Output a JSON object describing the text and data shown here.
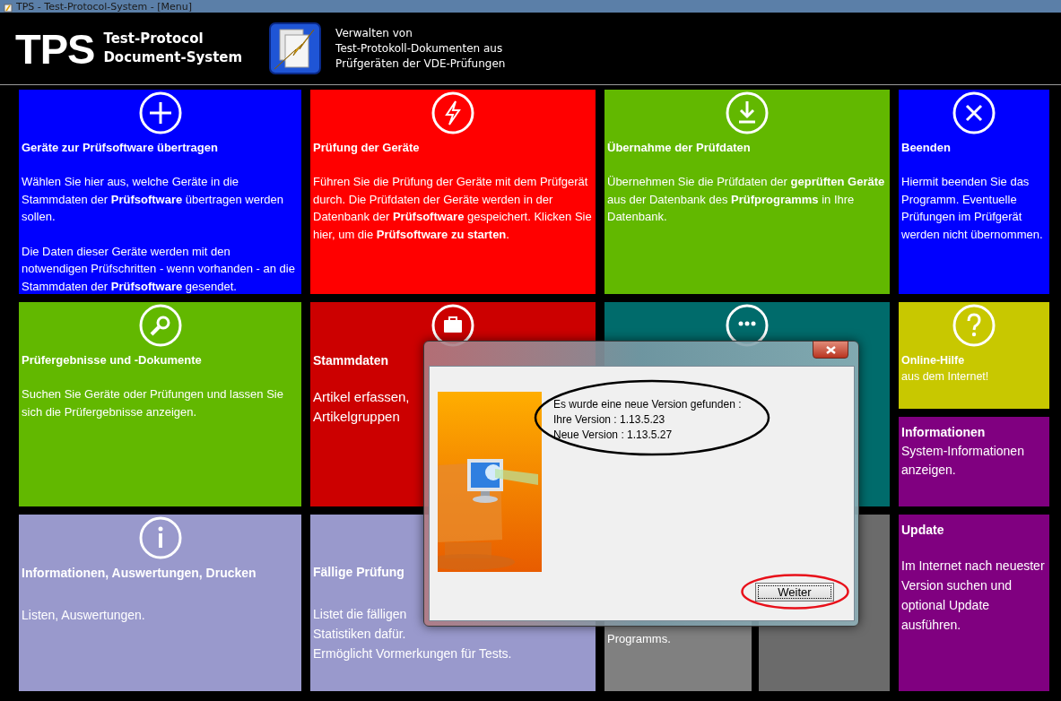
{
  "window": {
    "title": "TPS - Test-Protocol-System - [Menu]"
  },
  "header": {
    "logo": "TPS",
    "product_name": [
      "Test-Protocol",
      "Document-System"
    ],
    "description": [
      "Verwalten von",
      "Test-Protokoll-Dokumenten aus",
      "Prüfgeräten der VDE-Prüfungen"
    ]
  },
  "tiles": [
    {
      "color": "#0000ff",
      "title": "Geräte zur Prüfsoftware übertragen",
      "body": [
        "Wählen Sie hier aus, welche Geräte in die Stammdaten der **Prüfsoftware** übertragen werden sollen.",
        "Die Daten dieser Geräte werden mit den notwendigen Prüfschritten - wenn vorhanden - an die Stammdaten  der **Prüfsoftware** gesendet."
      ]
    },
    {
      "color": "#ff0000",
      "title": "Prüfung der Geräte",
      "body": [
        "Führen Sie die Prüfung der Geräte mit dem Prüfgerät durch. Die Prüfdaten der Geräte werden in der Datenbank der **Prüfsoftware** gespeichert. Klicken Sie hier, um die **Prüfsoftware zu starten**."
      ]
    },
    {
      "color": "#62b800",
      "title": "Übernahme der Prüfdaten",
      "body": [
        "Übernehmen Sie die Prüfdaten der **geprüften Geräte** aus der Datenbank des **Prüfprogramms** in Ihre Datenbank."
      ]
    },
    {
      "color": "#0000ff",
      "title": "Beenden",
      "body": [
        "Hiermit beenden Sie das Programm. Eventuelle Prüfungen im Prüfgerät werden nicht übernommen."
      ]
    },
    {
      "color": "#62b800",
      "title": "Prüfergebnisse und -Dokumente",
      "body": [
        "Suchen Sie Geräte oder Prüfungen und lassen Sie sich die Prüfergebnisse anzeigen."
      ]
    },
    {
      "color": "#cc0000",
      "title": "Stammdaten",
      "body": [
        "Artikel erfassen,",
        "Artikelgruppen"
      ]
    },
    {
      "color": "#006b6b"
    },
    {
      "color": "#c8c800",
      "title": "Online-Hilfe",
      "body": [
        "aus dem Internet!"
      ]
    },
    {
      "color": "#800080",
      "title": "Informationen",
      "body": [
        "System-Informationen anzeigen."
      ]
    },
    {
      "color": "#9999cc",
      "title": "Informationen, Auswertungen, Drucken",
      "body": [
        "Listen, Auswertungen."
      ]
    },
    {
      "color": "#9999cc",
      "title": "Fällige Prüfung",
      "body": [
        "Listet die fälligen",
        "Statistiken dafür.",
        "Ermöglicht Vormerkungen für Tests."
      ]
    },
    {
      "color": "#808080",
      "body": [
        "Programms."
      ]
    },
    {
      "color": "#6b6b6b"
    },
    {
      "color": "#800080",
      "title": "Update",
      "body": [
        "Im Internet nach neuester Version suchen und optional Update ausführen."
      ]
    }
  ],
  "dialog": {
    "message": [
      "Es wurde eine neue Version gefunden :",
      "Ihre Version : 1.13.5.23",
      "Neue Version : 1.13.5.27"
    ],
    "button": "Weiter"
  }
}
